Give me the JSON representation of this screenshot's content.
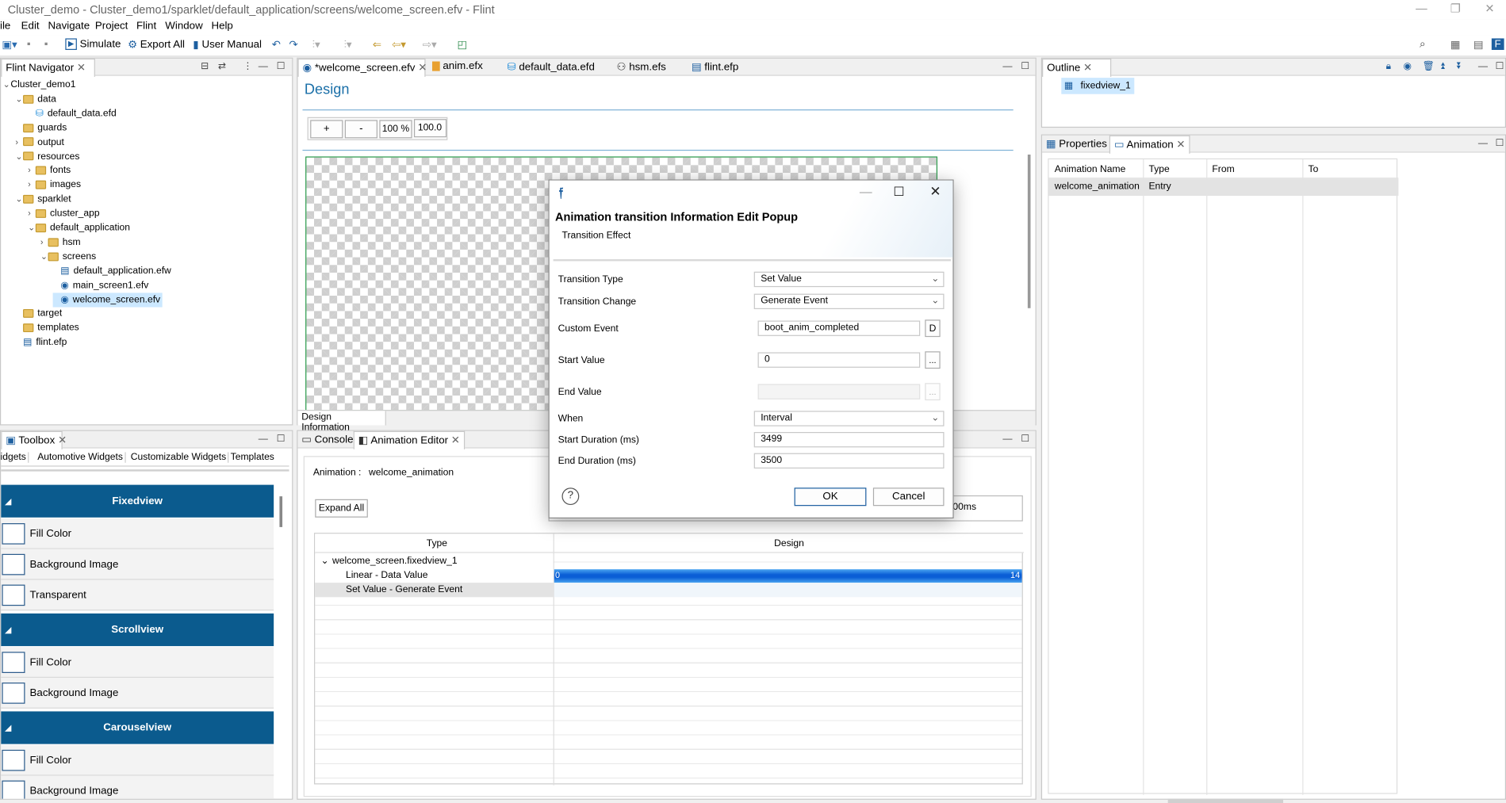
{
  "window": {
    "title": "Cluster_demo - Cluster_demo1/sparklet/default_application/screens/welcome_screen.efv - Flint",
    "minimize": "—",
    "restore": "❐",
    "close": "✕"
  },
  "menu": [
    "ile",
    "Edit",
    "Navigate",
    "Project",
    "Flint",
    "Window",
    "Help"
  ],
  "toolbar": {
    "simulate": "Simulate",
    "export_all": "Export All",
    "user_manual": "User Manual"
  },
  "navigator": {
    "tab": "Flint Navigator",
    "rows": [
      {
        "label": "Cluster_demo1",
        "depth": 0,
        "chev": "⌄",
        "kind": "project"
      },
      {
        "label": "data",
        "depth": 1,
        "chev": "⌄",
        "kind": "folder"
      },
      {
        "label": "default_data.efd",
        "depth": 2,
        "chev": "",
        "kind": "db"
      },
      {
        "label": "guards",
        "depth": 1,
        "chev": "",
        "kind": "folder"
      },
      {
        "label": "output",
        "depth": 1,
        "chev": "›",
        "kind": "folder"
      },
      {
        "label": "resources",
        "depth": 1,
        "chev": "⌄",
        "kind": "folder"
      },
      {
        "label": "fonts",
        "depth": 2,
        "chev": "›",
        "kind": "folder"
      },
      {
        "label": "images",
        "depth": 2,
        "chev": "›",
        "kind": "folder"
      },
      {
        "label": "sparklet",
        "depth": 1,
        "chev": "⌄",
        "kind": "folder"
      },
      {
        "label": "cluster_app",
        "depth": 2,
        "chev": "›",
        "kind": "folder"
      },
      {
        "label": "default_application",
        "depth": 2,
        "chev": "⌄",
        "kind": "folder"
      },
      {
        "label": "hsm",
        "depth": 3,
        "chev": "›",
        "kind": "folder"
      },
      {
        "label": "screens",
        "depth": 3,
        "chev": "⌄",
        "kind": "folder"
      },
      {
        "label": "default_application.efw",
        "depth": 4,
        "chev": "",
        "kind": "file"
      },
      {
        "label": "main_screen1.efv",
        "depth": 4,
        "chev": "",
        "kind": "eye"
      },
      {
        "label": "welcome_screen.efv",
        "depth": 4,
        "chev": "",
        "kind": "eye",
        "selected": true
      },
      {
        "label": "target",
        "depth": 1,
        "chev": "",
        "kind": "folder"
      },
      {
        "label": "templates",
        "depth": 1,
        "chev": "",
        "kind": "folder"
      },
      {
        "label": "flint.efp",
        "depth": 1,
        "chev": "",
        "kind": "file"
      }
    ]
  },
  "editor_tabs": [
    "*welcome_screen.efv",
    "anim.efx",
    "default_data.efd",
    "hsm.efs",
    "flint.efp"
  ],
  "design": {
    "heading": "Design",
    "plus": "+",
    "minus": "-",
    "zoom_pct": "100 %",
    "zoom_value": "100.0",
    "info_tab": "Design Information"
  },
  "outline": {
    "tab": "Outline",
    "item": "fixedview_1"
  },
  "props": {
    "tab_properties": "Properties",
    "tab_animation": "Animation",
    "headers": [
      "Animation Name",
      "Type",
      "From",
      "To"
    ],
    "row": [
      "welcome_animation",
      "Entry",
      "",
      ""
    ]
  },
  "toolbox": {
    "tab": "Toolbox",
    "categories": [
      "Widgets",
      "Automotive Widgets",
      "Customizable Widgets",
      "Templates"
    ],
    "sections": [
      {
        "title": "Fixedview",
        "items": [
          "Fill Color",
          "Background Image",
          "Transparent"
        ]
      },
      {
        "title": "Scrollview",
        "items": [
          "Fill Color",
          "Background Image"
        ]
      },
      {
        "title": "Carouselview",
        "items": [
          "Fill Color",
          "Background Image"
        ]
      }
    ]
  },
  "bottom": {
    "tab_console": "Console",
    "tab_anim_editor": "Animation Editor",
    "animation_label": "Animation :",
    "animation_name": "welcome_animation",
    "expand_all": "Expand All",
    "duration_fragment": "00ms",
    "col_type": "Type",
    "col_design": "Design",
    "rows": [
      "welcome_screen.fixedview_1",
      "Linear - Data Value",
      "Set Value - Generate Event"
    ],
    "bar_start": "0",
    "bar_end": "14"
  },
  "dialog": {
    "title": "Animation transition Information Edit Popup",
    "subtitle": "Transition Effect",
    "transition_type_label": "Transition Type",
    "transition_type_value": "Set Value",
    "transition_change_label": "Transition Change",
    "transition_change_value": "Generate Event",
    "custom_event_label": "Custom Event",
    "custom_event_value": "boot_anim_completed",
    "custom_event_btn": "D",
    "start_value_label": "Start Value",
    "start_value_value": "0",
    "start_value_btn": "...",
    "end_value_label": "End Value",
    "end_value_btn": "...",
    "when_label": "When",
    "when_value": "Interval",
    "start_duration_label": "Start Duration (ms)",
    "start_duration_value": "3499",
    "end_duration_label": "End Duration (ms)",
    "end_duration_value": "3500",
    "ok": "OK",
    "cancel": "Cancel",
    "help": "?"
  },
  "colors": {
    "accent": "#0b5b8e",
    "selection": "#cce8ff",
    "design_heading": "#1a6fa8"
  }
}
